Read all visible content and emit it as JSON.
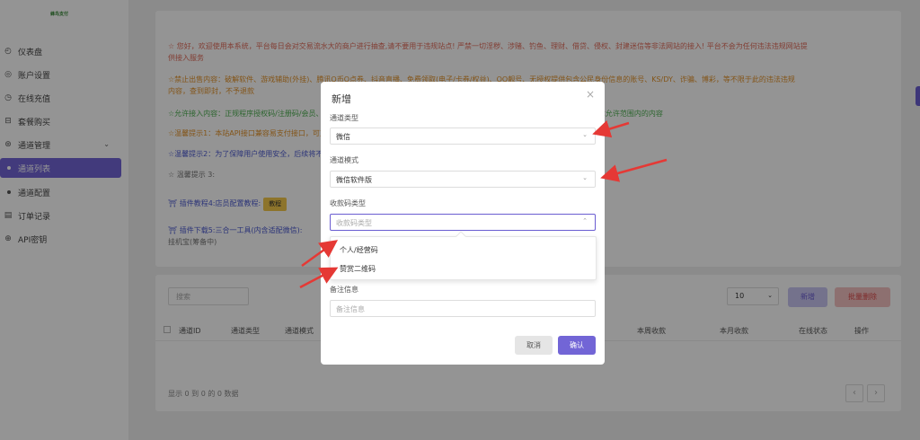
{
  "sidebar": {
    "logo": "蜂鸟支付",
    "items": [
      {
        "icon": "dashboard-icon",
        "glyph": "◴",
        "label": "仪表盘"
      },
      {
        "icon": "account-icon",
        "glyph": "◎",
        "label": "账户设置"
      },
      {
        "icon": "recharge-icon",
        "glyph": "◷",
        "label": "在线充值"
      },
      {
        "icon": "package-icon",
        "glyph": "⊟",
        "label": "套餐购买"
      },
      {
        "icon": "channel-icon",
        "glyph": "⊛",
        "label": "通道管理"
      },
      {
        "label": "通道列表"
      },
      {
        "label": "通道配置"
      },
      {
        "icon": "order-icon",
        "glyph": "▤",
        "label": "订单记录"
      },
      {
        "icon": "api-icon",
        "glyph": "⊕",
        "label": "API密钥"
      }
    ]
  },
  "notices": {
    "n1a": "☆ 您好，欢迎使用本系统，平台每日会对交易流水大的商户进行抽查,请不要用于违规站点! 严禁一切淫秽、涉赌、钓鱼、理财、借贷、侵权、封建迷信等非法网站的接入! 平台不会为任何违法违规网站提",
    "n1b": "供接入服务",
    "n2a": "☆禁止出售内容：破解软件、游戏辅助(外挂)、腾讯Q币Q点券、抖音直播、免费领取(电子/卡券/权益)、QQ靓号、无授权提供包含公民身份信息的账号、KS/DY、诈骗、博彩，等不限于此的违法违规",
    "n2b": "内容，查到即封，不予退款",
    "n3": "☆允许接入内容：正规程序授权码/注册码/会员、网站资源下载、开发/代码等虚拟物品交易，正规付费服务,实物电商,正规虚拟充值,等法律允许范围内的内容",
    "n4": "☆温馨提示1：本站API接口兼容易支付接口，可直接对接易支付插件。",
    "n5": "☆温馨提示2：为了保障用户使用安全，后续将不再提供下载的免挂软件。",
    "n6": "☆ 温馨提示 3:",
    "n7": "插件教程4:店员配置教程:",
    "n7btn": "教程",
    "n8": "插件下载5:三合一工具(内含适配微信):",
    "n9": "挂机宝(筹备中)"
  },
  "toolbar": {
    "search_placeholder": "搜索",
    "page_size": "10",
    "add_label": "新增",
    "batch_delete_label": "批量删除"
  },
  "table": {
    "columns": [
      "通道ID",
      "通道类型",
      "通道模式",
      "本周收款",
      "本月收款",
      "在线状态",
      "操作"
    ],
    "footer": "显示 0 到 0 的 0 数据",
    "prev": "‹",
    "next": "›"
  },
  "modal": {
    "title": "新增",
    "close": "×",
    "channel_type_label": "通道类型",
    "channel_type_value": "微信",
    "channel_mode_label": "通道模式",
    "channel_mode_value": "微信软件版",
    "qr_type_label": "收款码类型",
    "qr_type_placeholder": "收款码类型",
    "qr_options": [
      "个人/经营码",
      "赞赏二维码"
    ],
    "remark_label": "备注信息",
    "remark_placeholder": "备注信息",
    "cancel_label": "取消",
    "confirm_label": "确认"
  },
  "colors": {
    "accent": "#7265d6",
    "annotation_arrow": "#e53935"
  }
}
